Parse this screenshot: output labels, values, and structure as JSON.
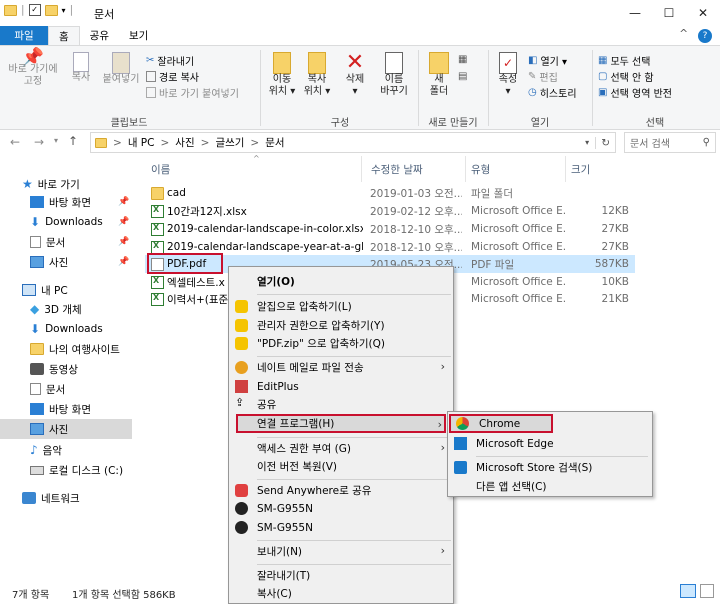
{
  "window": {
    "title": "문서",
    "controls": {
      "minimize": "—",
      "maximize": "☐",
      "close": "✕"
    }
  },
  "ribbon_tabs": [
    {
      "label": "파일"
    },
    {
      "label": "홈"
    },
    {
      "label": "공유"
    },
    {
      "label": "보기"
    }
  ],
  "ribbon": {
    "clipboard": {
      "pin": "바로 가기에\n고정",
      "copy": "복사",
      "paste": "붙여넣기",
      "cut": "잘라내기",
      "copy_path": "경로 복사",
      "paste_shortcut": "바로 가기 붙여넣기",
      "label": "클립보드"
    },
    "organize": {
      "move_to": "이동\n위치 ▾",
      "copy_to": "복사\n위치 ▾",
      "delete": "삭제\n▾",
      "rename": "이름\n바꾸기",
      "label": "구성"
    },
    "new": {
      "new_folder": "새\n폴더",
      "label": "새로 만들기"
    },
    "open": {
      "properties": "속성\n▾",
      "open": "열기 ▾",
      "edit": "편집",
      "history": "히스토리",
      "label": "열기"
    },
    "select": {
      "select_all": "모두 선택",
      "select_none": "선택 안 함",
      "invert": "선택 영역 반전",
      "label": "선택"
    },
    "collapse": "^",
    "help": "?"
  },
  "address": {
    "breadcrumbs": [
      "내 PC",
      "사진",
      "글쓰기",
      "문서"
    ],
    "separator": ">",
    "search_placeholder": "문서 검색"
  },
  "nav": [
    {
      "label": "바로 가기",
      "pinned": false
    },
    {
      "label": "바탕 화면",
      "pinned": true
    },
    {
      "label": "Downloads",
      "pinned": true
    },
    {
      "label": "문서",
      "pinned": true
    },
    {
      "label": "사진",
      "pinned": true
    },
    {
      "label": "내 PC",
      "pinned": false
    },
    {
      "label": "3D 개체",
      "pinned": false
    },
    {
      "label": "Downloads",
      "pinned": false
    },
    {
      "label": "나의 여행사이트",
      "pinned": false
    },
    {
      "label": "동영상",
      "pinned": false
    },
    {
      "label": "문서",
      "pinned": false
    },
    {
      "label": "바탕 화면",
      "pinned": false
    },
    {
      "label": "사진",
      "pinned": false
    },
    {
      "label": "음악",
      "pinned": false
    },
    {
      "label": "로컬 디스크 (C:)",
      "pinned": false
    },
    {
      "label": "네트워크",
      "pinned": false
    }
  ],
  "columns": [
    "이름",
    "수정한 날짜",
    "유형",
    "크기"
  ],
  "files": [
    {
      "name": "cad",
      "date": "2019-01-03 오전...",
      "type": "파일 폴더",
      "size": "",
      "icon": "folder-icon"
    },
    {
      "name": "10간과12지.xlsx",
      "date": "2019-02-12 오후...",
      "type": "Microsoft Office E...",
      "size": "12KB",
      "icon": "excel-icon"
    },
    {
      "name": "2019-calendar-landscape-in-color.xlsx",
      "date": "2018-12-10 오후...",
      "type": "Microsoft Office E...",
      "size": "27KB",
      "icon": "excel-icon"
    },
    {
      "name": "2019-calendar-landscape-year-at-a-glan...",
      "date": "2018-12-10 오후...",
      "type": "Microsoft Office E...",
      "size": "27KB",
      "icon": "excel-icon"
    },
    {
      "name": "PDF.pdf",
      "date": "2019-05-23 오전...",
      "type": "PDF 파일",
      "size": "587KB",
      "icon": "pdf-icon"
    },
    {
      "name": "엑셀테스트.x",
      "date": "",
      "type": "Microsoft Office E...",
      "size": "10KB",
      "icon": "excel-icon"
    },
    {
      "name": "이력서+(표준",
      "date": "",
      "type": "Microsoft Office E...",
      "size": "21KB",
      "icon": "excel-icon"
    }
  ],
  "context_menu": [
    {
      "label": "열기(O)",
      "bold": true
    },
    {
      "sep": true
    },
    {
      "label": "알집으로 압축하기(L)",
      "icon": "alzip-icon"
    },
    {
      "label": "관리자 권한으로 압축하기(Y)",
      "icon": "alzip-icon"
    },
    {
      "label": "\"PDF.zip\" 으로 압축하기(Q)",
      "icon": "alzip-icon"
    },
    {
      "sep": true
    },
    {
      "label": "네이트 메일로 파일 전송",
      "icon": "nate-icon",
      "arrow": true
    },
    {
      "label": "EditPlus",
      "icon": "editplus-icon"
    },
    {
      "label": "공유",
      "icon": "share-icon"
    },
    {
      "label": "연결 프로그램(H)",
      "arrow": true,
      "highlight": true
    },
    {
      "sep": true
    },
    {
      "label": "액세스 권한 부여 (G)",
      "arrow": true
    },
    {
      "label": "이전 버전 복원(V)"
    },
    {
      "sep": true
    },
    {
      "label": "Send Anywhere로 공유",
      "icon": "sendanywhere-icon"
    },
    {
      "label": "SM-G955N",
      "icon": "device-icon"
    },
    {
      "label": "SM-G955N",
      "icon": "device-icon"
    },
    {
      "sep": true
    },
    {
      "label": "보내기(N)",
      "arrow": true
    },
    {
      "sep": true
    },
    {
      "label": "잘라내기(T)"
    },
    {
      "label": "복사(C)"
    }
  ],
  "submenu": [
    {
      "label": "Chrome",
      "icon": "chrome-icon",
      "highlight": true
    },
    {
      "label": "Microsoft Edge",
      "icon": "edge-icon"
    },
    {
      "sep": true
    },
    {
      "label": "Microsoft Store 검색(S)",
      "icon": "store-icon"
    },
    {
      "label": "다른 앱 선택(C)"
    }
  ],
  "status": {
    "count": "7개 항목",
    "selection": "1개 항목 선택함 586KB"
  },
  "colors": {
    "file_tab": "#1979ca",
    "selection": "#cce8ff",
    "highlight_border": "#c8102e"
  }
}
